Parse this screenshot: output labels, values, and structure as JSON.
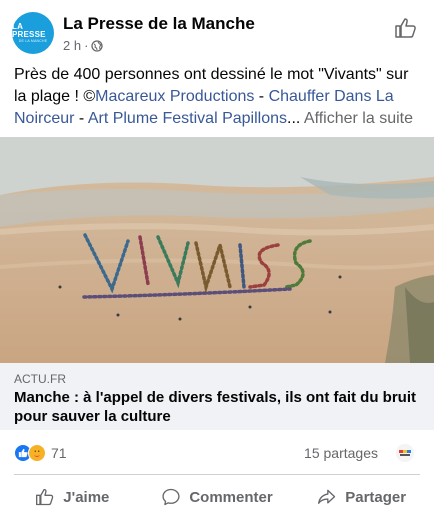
{
  "post": {
    "page_name": "La Presse de la Manche",
    "avatar_line1": "LA PRESSE",
    "avatar_line2": "DE LA MANCHE",
    "time": "2 h",
    "dot": "·",
    "privacy_icon": "globe-icon",
    "header_action_icon": "thumbs-up-icon",
    "text_main": "Près de 400 personnes ont dessiné le mot \"Vivants\" sur la plage ! ©",
    "link1": "Macareux Productions",
    "sep1": " - ",
    "link2": "Chauffer Dans La Noirceur",
    "sep2": " - ",
    "link3": "Art Plume Festival Papillons",
    "ellipsis": "...",
    "see_more": "Afficher la suite"
  },
  "link_preview": {
    "domain": "ACTU.FR",
    "title": "Manche : à l'appel de divers festivals, ils ont fait du bruit pour sauver la culture"
  },
  "stats": {
    "reactions_count": "71",
    "shares": "15 partages"
  },
  "actions": {
    "like": "J'aime",
    "comment": "Commenter",
    "share": "Partager"
  },
  "colors": {
    "brand": "#1877f2",
    "link": "#385898",
    "muted": "#65676b",
    "avatar_bg": "#1a9fdc"
  }
}
